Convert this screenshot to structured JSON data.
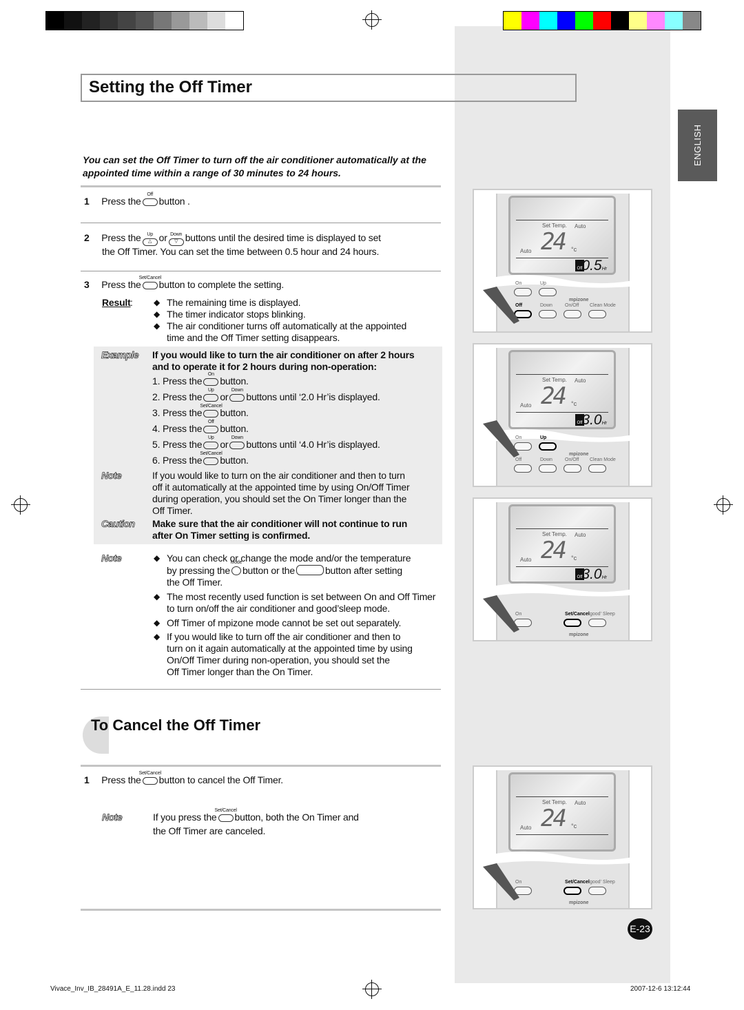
{
  "title": "Setting the Off Timer",
  "side_tab": "ENGLISH",
  "intro": "You can set the Off Timer to turn off the air conditioner automatically at the appointed time within a range of 30 minutes to 24 hours.",
  "steps": [
    {
      "n": "1",
      "pre": "Press the",
      "btn": "Off",
      "post": "button ."
    },
    {
      "n": "2",
      "pre": "Press the",
      "btn": "Up",
      "mid": "or",
      "btn2": "Down",
      "post": "buttons until the desired time is displayed to set",
      "line2": "the Off Timer. You can set the time between 0.5 hour and 24 hours."
    },
    {
      "n": "3",
      "pre": "Press the",
      "btn": "Set/Cancel",
      "post": "button to complete the setting."
    }
  ],
  "result_label": "Result",
  "results": [
    "The remaining time is displayed.",
    "The timer indicator stops blinking.",
    "The air conditioner turns off automatically at the appointed",
    "time and the Off Timer setting disappears."
  ],
  "example": {
    "tag": "Example",
    "heading1": "If you would like to turn the air conditioner on after 2 hours",
    "heading2": "and to operate it for 2 hours during non-operation:",
    "items": [
      {
        "pre": "1. Press the",
        "btn": "On",
        "post": "button."
      },
      {
        "pre": "2. Press the",
        "btn": "Up",
        "mid": "or",
        "btn2": "Down",
        "post": "buttons until ‘2.0 Hr’is displayed."
      },
      {
        "pre": "3. Press the",
        "btn": "Set/Cancel",
        "post": "button."
      },
      {
        "pre": "4. Press the",
        "btn": "Off",
        "post": "button."
      },
      {
        "pre": "5. Press the",
        "btn": "Up",
        "mid": "or",
        "btn2": "Down",
        "post": "buttons until ‘4.0 Hr’is displayed."
      },
      {
        "pre": "6. Press the",
        "btn": "Set/Cancel",
        "post": "button."
      }
    ],
    "note_tag": "Note",
    "note": [
      "If you would like to turn on the air conditioner and then to turn",
      "off it automatically at the appointed time by using On/Off Timer",
      "during operation, you should set the On Timer longer than the",
      "Off Timer."
    ],
    "caution_tag": "Caution",
    "caution": [
      "Make sure that the air conditioner will not continue to run",
      "after On Timer setting is confirmed."
    ]
  },
  "note2": {
    "tag": "Note",
    "b1a": "You can check or change the mode and/or the temperature",
    "b1b_pre": "by pressing the",
    "b1b_btn": "Mode",
    "b1b_mid": "button or the",
    "b1b_post": "button after setting",
    "b1c": "the Off Timer.",
    "b2": [
      "The most recently used function is set between On and Off Timer",
      "to turn on/off the air conditioner and good’sleep mode."
    ],
    "b3": "Off Timer of mpizone mode cannot be set out separately.",
    "b4": [
      "If you would like to turn off the air conditioner and then to",
      "turn on it again automatically at the appointed time by using",
      "On/Off Timer during non-operation, you should set the",
      "Off Timer longer than the On Timer."
    ]
  },
  "cancel": {
    "heading": "To Cancel the Off Timer",
    "step": {
      "n": "1",
      "pre": "Press the",
      "btn": "Set/Cancel",
      "post": "button to cancel the Off Timer."
    },
    "note_tag": "Note",
    "note_pre": "If you press the",
    "note_btn": "Set/Cancel",
    "note_post": "button, both the On Timer and",
    "note_line2": "the Off Timer are canceled."
  },
  "remotes": [
    {
      "temp": "24",
      "unit": "°c",
      "set_temp": "Set Temp.",
      "auto": "Auto",
      "timer": "0.5",
      "hr": "Hr",
      "off": "Off",
      "buttons": [
        "On",
        "Up",
        "Off",
        "Down",
        "On/Off",
        "Clean Mode"
      ],
      "brand": "mpizone",
      "pressed": "Off"
    },
    {
      "temp": "24",
      "unit": "°c",
      "set_temp": "Set Temp.",
      "auto": "Auto",
      "timer": "3.0",
      "hr": "Hr",
      "off": "Off",
      "buttons": [
        "On",
        "Up",
        "Off",
        "Down",
        "On/Off",
        "Clean Mode"
      ],
      "brand": "mpizone",
      "pressed": "Up"
    },
    {
      "temp": "24",
      "unit": "°c",
      "set_temp": "Set Temp.",
      "auto": "Auto",
      "timer": "3.0",
      "hr": "Hr",
      "off": "Off",
      "buttons": [
        "On",
        "Set/Cancel",
        "good' Sleep"
      ],
      "brand": "mpizone",
      "pressed": "Set/Cancel"
    },
    {
      "temp": "24",
      "unit": "°c",
      "set_temp": "Set Temp.",
      "auto": "Auto",
      "timer": "",
      "hr": "",
      "off": "",
      "buttons": [
        "On",
        "Set/Cancel",
        "good' Sleep"
      ],
      "brand": "mpizone",
      "pressed": "Set/Cancel"
    }
  ],
  "page_number": "E-23",
  "footer": {
    "file": "Vivace_Inv_IB_28491A_E_11.28.indd   23",
    "date": "2007-12-6   13:12:44"
  },
  "colors": {
    "gray_bars": [
      "#000000",
      "#111111",
      "#222222",
      "#333333",
      "#444444",
      "#555555",
      "#777777",
      "#999999",
      "#bbbbbb",
      "#dddddd",
      "#ffffff"
    ],
    "color_bars": [
      "#ffff00",
      "#ff00ff",
      "#00ffff",
      "#0000ff",
      "#00ff00",
      "#ff0000",
      "#000000",
      "#ffff88",
      "#ff88ff",
      "#88ffff",
      "#888888"
    ]
  }
}
